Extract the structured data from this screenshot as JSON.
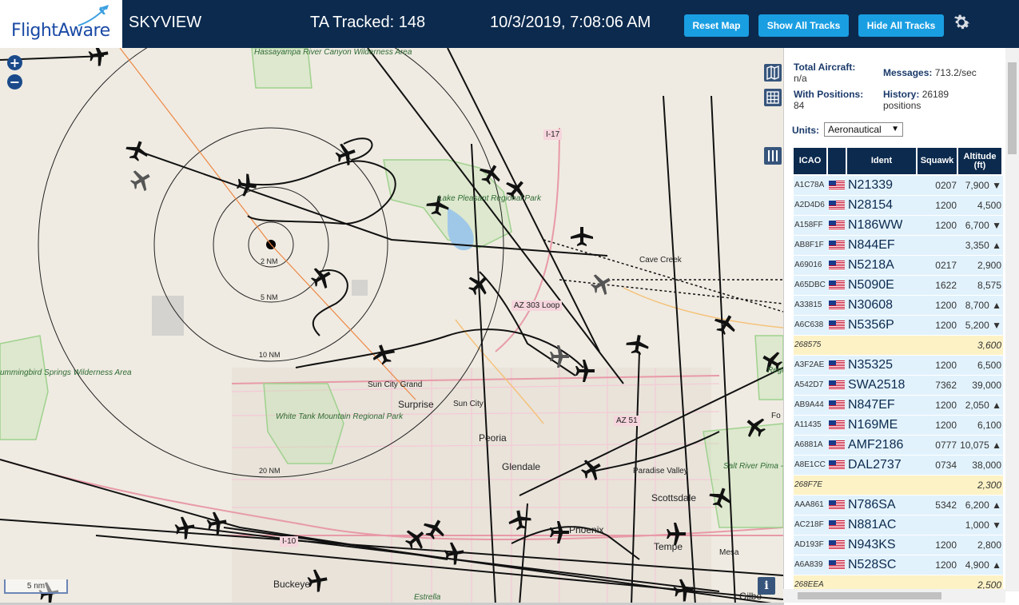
{
  "header": {
    "logo_text": "FlightAware",
    "app_name": "SKYVIEW",
    "tracked": "TA Tracked: 148",
    "datetime": "10/3/2019, 7:08:06 AM",
    "reset_map": "Reset Map",
    "show_all_tracks": "Show All Tracks",
    "hide_all_tracks": "Hide All Tracks",
    "settings_icon": "gear-icon"
  },
  "map": {
    "zoom_in": "+",
    "zoom_out": "−",
    "scale_label": "5 nm",
    "info": "i",
    "range_rings": [
      "2 NM",
      "5 NM",
      "10 NM",
      "20 NM"
    ],
    "places": {
      "hassayampa": "Hassayampa River Canyon Wilderness Area",
      "lake_pleasant": "Lake Pleasant Regional Park",
      "cave_creek": "Cave Creek",
      "az303": "AZ 303 Loop",
      "i17": "I-17",
      "sun_city_grand": "Sun City Grand",
      "surprise": "Surprise",
      "sun_city": "Sun City",
      "peoria": "Peoria",
      "glendale": "Glendale",
      "paradise_valley": "Paradise Valley",
      "scottsdale": "Scottsdale",
      "phoenix": "Phoenix",
      "tempe": "Tempe",
      "mesa": "Mesa",
      "buckeye": "Buckeye",
      "estrella": "Estrella",
      "gilbert": "Gilbe",
      "white_tank": "White Tank Mountain Regional Park",
      "hummingbird": "ummingbird Springs Wilderness Area",
      "salt_river": "Salt River Pima - Maricopa Indian Community",
      "az51": "AZ 51",
      "i10": "I-10",
      "fo": "Fo",
      "tonto": "Regi Pa"
    }
  },
  "sidebar": {
    "total_aircraft_label": "Total Aircraft:",
    "total_aircraft_value": "n/a",
    "with_positions_label": "With Positions:",
    "with_positions_value": "84",
    "messages_label": "Messages:",
    "messages_value": "713.2/sec",
    "history_label": "History:",
    "history_value": "26189 positions",
    "units_label": "Units:",
    "units_value": "Aeronautical",
    "columns": [
      "ICAO",
      "Ident",
      "Squawk",
      "Altitude (ft)"
    ],
    "rows": [
      {
        "icao": "A1C78A",
        "ident": "N21339",
        "squawk": "0207",
        "alt": "7,900 ▼",
        "flag": true
      },
      {
        "icao": "A2D4D6",
        "ident": "N28154",
        "squawk": "1200",
        "alt": "4,500",
        "flag": true
      },
      {
        "icao": "A158FF",
        "ident": "N186WW",
        "squawk": "1200",
        "alt": "6,700 ▼",
        "flag": true
      },
      {
        "icao": "AB8F1F",
        "ident": "N844EF",
        "squawk": "",
        "alt": "3,350 ▲",
        "flag": true
      },
      {
        "icao": "A69016",
        "ident": "N5218A",
        "squawk": "0217",
        "alt": "2,900",
        "flag": true
      },
      {
        "icao": "A65DBC",
        "ident": "N5090E",
        "squawk": "1622",
        "alt": "8,575",
        "flag": true
      },
      {
        "icao": "A33815",
        "ident": "N30608",
        "squawk": "1200",
        "alt": "8,700 ▲",
        "flag": true
      },
      {
        "icao": "A6C638",
        "ident": "N5356P",
        "squawk": "1200",
        "alt": "5,200 ▼",
        "flag": true
      },
      {
        "icao": "268575",
        "ident": "",
        "squawk": "",
        "alt": "3,600",
        "flag": false
      },
      {
        "icao": "A3F2AE",
        "ident": "N35325",
        "squawk": "1200",
        "alt": "6,500",
        "flag": true
      },
      {
        "icao": "A542D7",
        "ident": "SWA2518",
        "squawk": "7362",
        "alt": "39,000",
        "flag": true
      },
      {
        "icao": "AB9A44",
        "ident": "N847EF",
        "squawk": "1200",
        "alt": "2,050 ▲",
        "flag": true
      },
      {
        "icao": "A11435",
        "ident": "N169ME",
        "squawk": "1200",
        "alt": "6,100",
        "flag": true
      },
      {
        "icao": "A6881A",
        "ident": "AMF2186",
        "squawk": "0777",
        "alt": "10,075 ▲",
        "flag": true
      },
      {
        "icao": "A8E1CC",
        "ident": "DAL2737",
        "squawk": "0734",
        "alt": "38,000",
        "flag": true
      },
      {
        "icao": "268F7E",
        "ident": "",
        "squawk": "",
        "alt": "2,300",
        "flag": false
      },
      {
        "icao": "AAA861",
        "ident": "N786SA",
        "squawk": "5342",
        "alt": "6,200 ▲",
        "flag": true
      },
      {
        "icao": "AC218F",
        "ident": "N881AC",
        "squawk": "",
        "alt": "1,000 ▼",
        "flag": true
      },
      {
        "icao": "AD193F",
        "ident": "N943KS",
        "squawk": "1200",
        "alt": "2,800",
        "flag": true
      },
      {
        "icao": "A6A839",
        "ident": "N528SC",
        "squawk": "1200",
        "alt": "4,900 ▲",
        "flag": true
      },
      {
        "icao": "268EEA",
        "ident": "",
        "squawk": "",
        "alt": "2,500",
        "flag": false
      }
    ]
  }
}
